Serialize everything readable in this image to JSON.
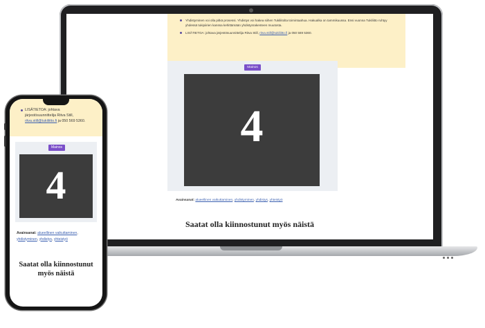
{
  "laptop": {
    "info_items": [
      "Yhdistyminen voi olla pitkä prosessi. Yhdistys voi hakea siihen Tukiliitolta toimintaa­hua. Hakualka on tammikuussa. Ensi vuonna Tukiliitto ruhtyy yhdessä tukipiirien kanssa kehittämään yhdistysrakenteen muutosta.",
      "LISÄTIETOA: johtava järjestösuunnittelija Ritva Still,"
    ],
    "info_link": "ritva.still@tukiliitto.fi",
    "info_tail": " ja 050 569 5360.",
    "ad_badge": "Mainos",
    "ad_number": "4",
    "tags_label": "Avainsanat:",
    "tags": [
      "alueellinen vaikuttaminen",
      "yhdistyminen",
      "yhdistys",
      "yhteistyö"
    ],
    "heading": "Saatat olla kiinnostunut myös näistä"
  },
  "phone": {
    "info_lines": [
      "LISÄTIETOA: johtava",
      "järjestösuunnittelija Ritva Still,"
    ],
    "info_link": "ritva.still@tukiliitto.fi",
    "info_tail": " ja 050 569 5360.",
    "ad_badge": "Mainos",
    "ad_number": "4",
    "tags_label": "Avainsanat:",
    "tags": [
      "alueellinen vaikuttaminen",
      "yhdistyminen",
      "yhdistys",
      "yhteistyö"
    ],
    "heading": "Saatat olla kiinnostunut myös näistä"
  }
}
